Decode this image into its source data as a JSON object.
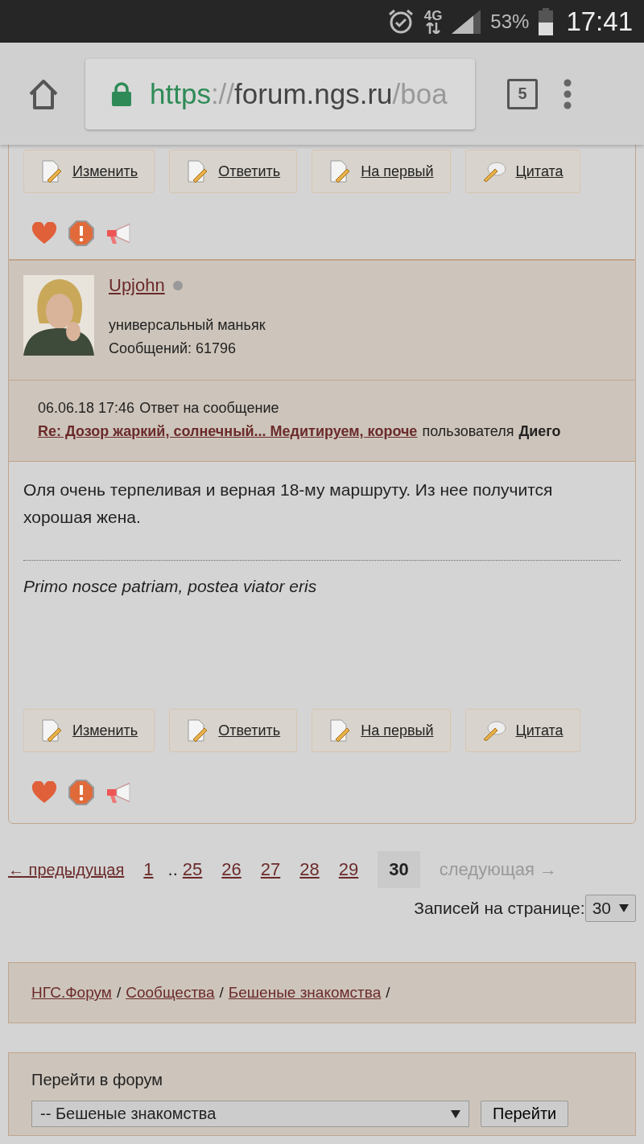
{
  "status_bar": {
    "network": "4G",
    "battery": "53%",
    "time": "17:41"
  },
  "browser": {
    "scheme": "https",
    "separator": "://",
    "host": "forum.ngs.ru",
    "path": "/boa",
    "tab_count": "5"
  },
  "previous_post": {
    "actions": [
      {
        "label": "Изменить",
        "kind": "edit"
      },
      {
        "label": "Ответить",
        "kind": "reply"
      },
      {
        "label": "На первый",
        "kind": "first"
      },
      {
        "label": "Цитата",
        "kind": "quote"
      }
    ]
  },
  "post": {
    "author": "Upjohn",
    "online": false,
    "rank": "универсальный маньяк",
    "posts_count": "Сообщений: 61796",
    "date": "06.06.18 17:46",
    "reply_prefix": "Ответ на сообщение",
    "reply_link": "Re: Дозор жаркий, солнечный... Медитируем, короче",
    "reply_suffix": "пользователя",
    "reply_author": "Диего",
    "body": "Оля очень терпеливая и верная 18-му маршруту. Из нее получится хорошая жена.",
    "signature": "Primo nosce patriam, postea viator eris",
    "actions": [
      {
        "label": "Изменить",
        "kind": "edit"
      },
      {
        "label": "Ответить",
        "kind": "reply"
      },
      {
        "label": "На первый",
        "kind": "first"
      },
      {
        "label": "Цитата",
        "kind": "quote"
      }
    ]
  },
  "pagination": {
    "previous": "← предыдущая",
    "ellipsis": "..",
    "pages": [
      {
        "label": "1",
        "selected": false
      },
      {
        "label": "25",
        "selected": false
      },
      {
        "label": "26",
        "selected": false
      },
      {
        "label": "27",
        "selected": false
      },
      {
        "label": "28",
        "selected": false
      },
      {
        "label": "29",
        "selected": false
      },
      {
        "label": "30",
        "selected": true
      }
    ],
    "next": "следующая →",
    "next_disabled": true,
    "per_page_label": "Записей на странице:",
    "per_page": "30"
  },
  "breadcrumbs": {
    "items": [
      "НГС.Форум",
      "Сообщества",
      "Бешеные знакомства"
    ],
    "separator": "/"
  },
  "forum_jump": {
    "label": "Перейти в форум",
    "selected_forum": "-- Бешеные знакомства",
    "button": "Перейти"
  }
}
